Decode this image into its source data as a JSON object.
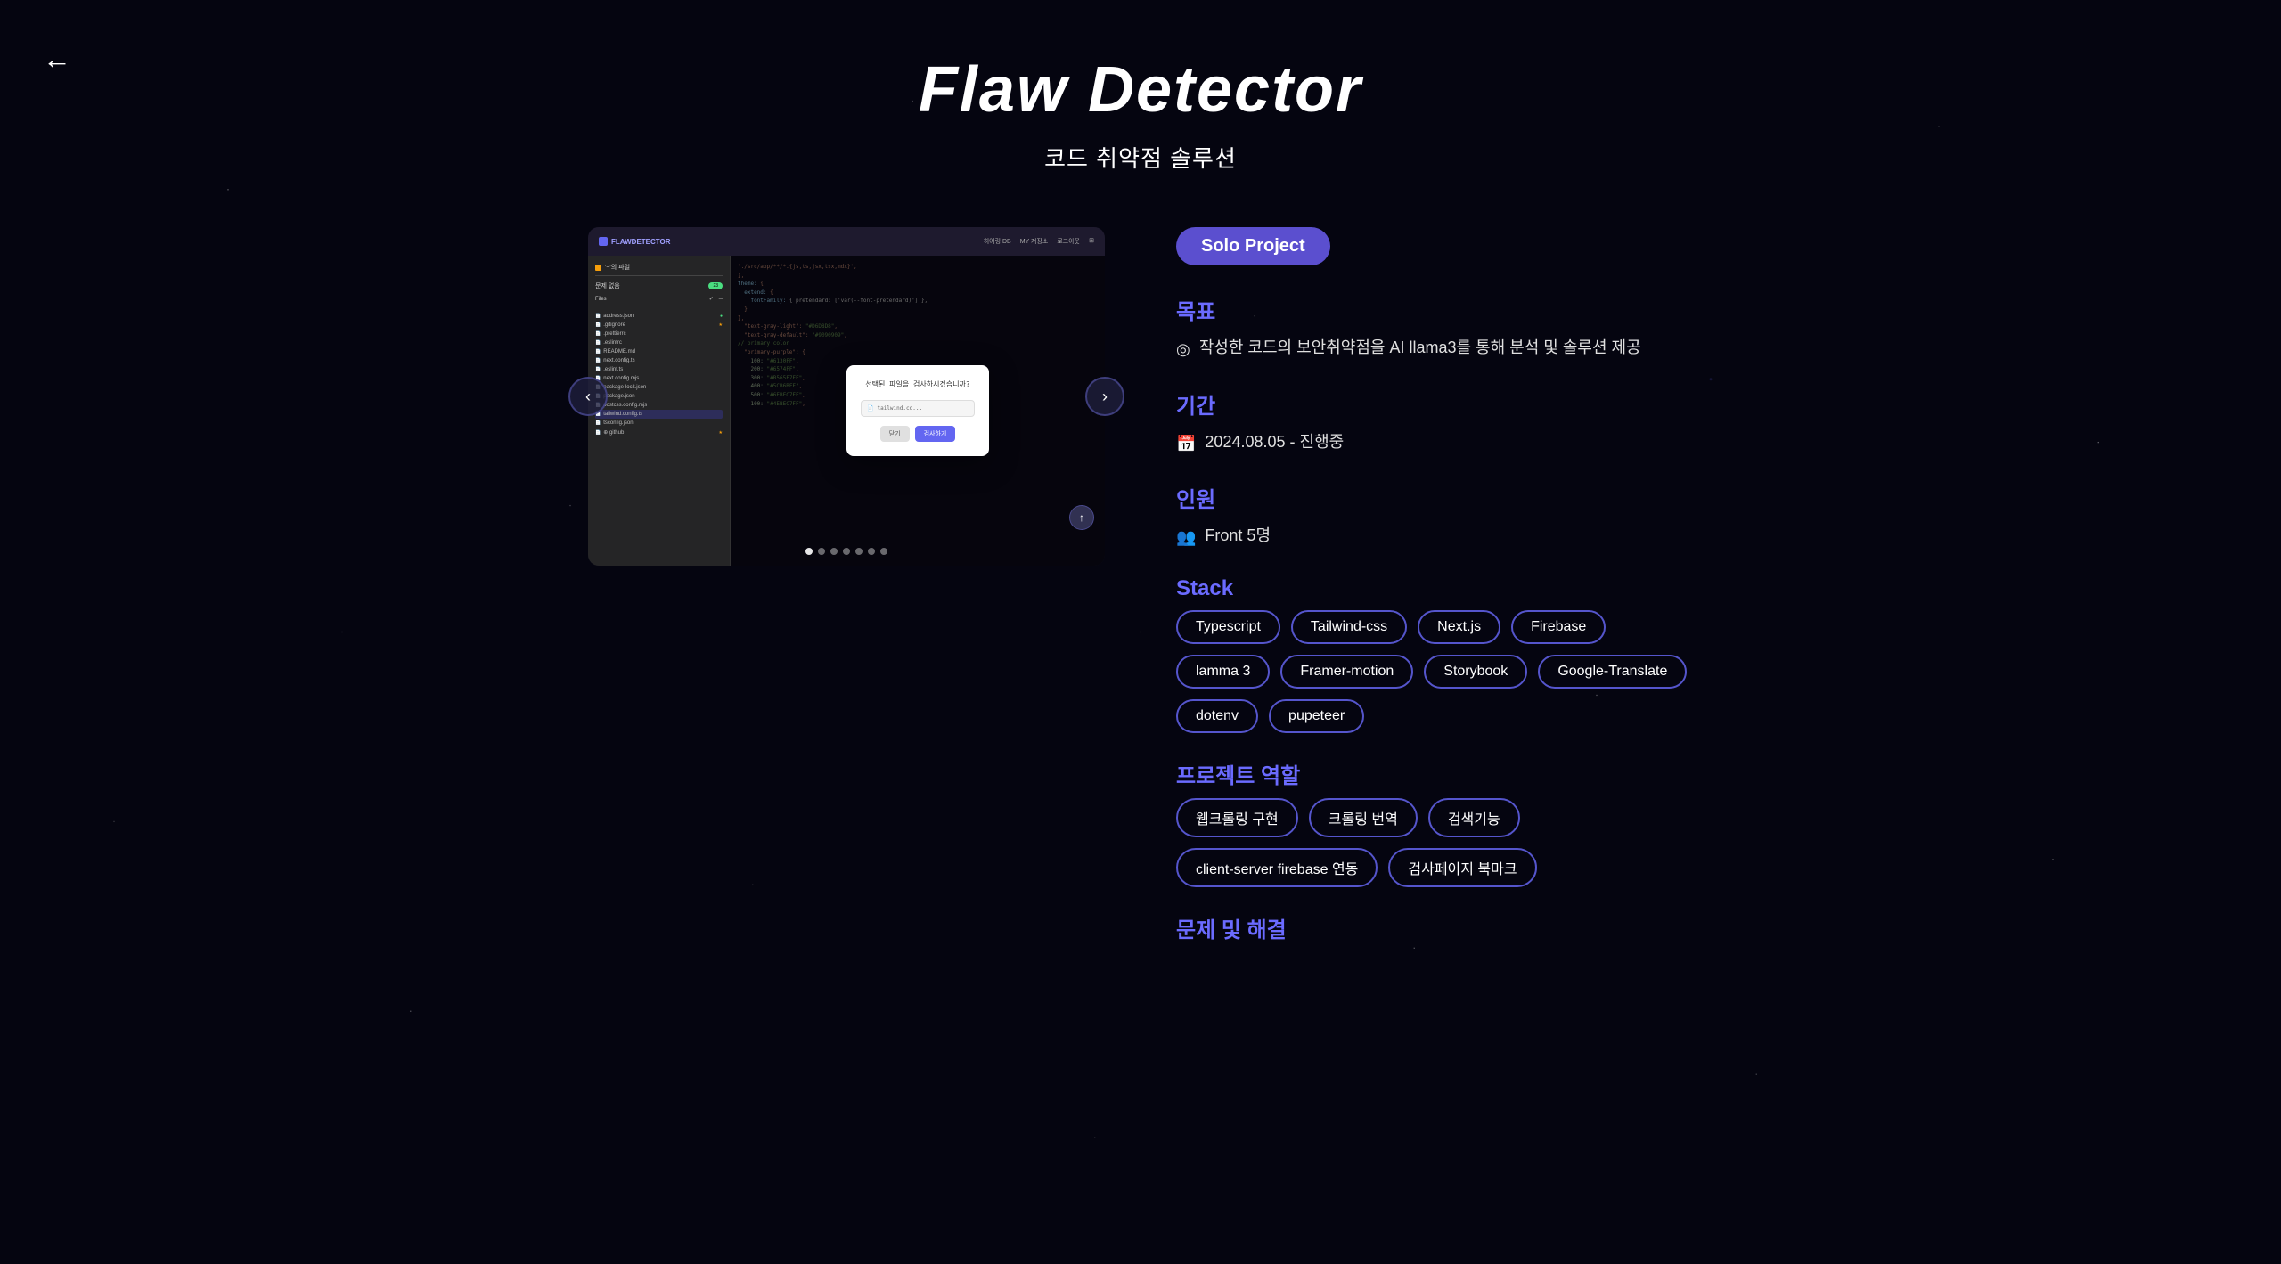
{
  "page": {
    "title": "Flaw Detector",
    "subtitle": "코드 취약점 솔루션",
    "back_label": "←"
  },
  "badge": {
    "label": "Solo Project"
  },
  "sections": {
    "goal": {
      "label": "목표",
      "icon": "◎",
      "content": "작성한 코드의 보안취약점을 AI llama3를 통해 분석 및 솔루션 제공"
    },
    "period": {
      "label": "기간",
      "icon": "📅",
      "content": "2024.08.05 - 진행중"
    },
    "team": {
      "label": "인원",
      "icon": "👥",
      "content": "Front 5명"
    },
    "stack": {
      "label": "Stack",
      "tags": [
        "Typescript",
        "Tailwind-css",
        "Next.js",
        "Firebase",
        "lamma 3",
        "Framer-motion",
        "Storybook",
        "Google-Translate",
        "dotenv",
        "pupeteer"
      ]
    },
    "role": {
      "label": "프로젝트 역할",
      "tags": [
        "웹크롤링 구현",
        "크롤링 번역",
        "검색기능",
        "client-server firebase 연동",
        "검사페이지 북마크"
      ]
    },
    "issues": {
      "label": "문제 및 해결"
    }
  },
  "carousel": {
    "dots_count": 7,
    "active_dot": 0
  },
  "mockup": {
    "logo": "FLAWDETECTOR",
    "nav_items": [
      "히어링 DB",
      "MY 저장소",
      "로그아웃"
    ],
    "modal_title": "선택된 파일을 검사하시겠습니까?",
    "modal_file": "tailwind.co...",
    "modal_cancel": "닫기",
    "modal_confirm": "검사하기",
    "file_count_label": "문제 없음",
    "file_count": "23",
    "files_header": "Files",
    "file_items": [
      "address.json",
      ".gitignore",
      ".prettierrc",
      ".eslintrc",
      "README.md",
      "next.config.ts",
      ".eslint.ts",
      "next.config.mjs",
      "package-lock.json",
      "package.json",
      "postcss.config.mjs",
      "tailwind.config.ts",
      "tsconfig.json"
    ],
    "code_lines": [
      "'./src/app/**/*.{js,ts,jsx,tsx,mdx}',",
      "},",
      "theme: {",
      "  extend: {",
      "    fontFamily: { pretendard: ['var(--font-pretendard)'] },",
      "  }",
      "},",
      "\"text-gray-light\": \"#D6D8D8\",",
      "\"text-gray-default\": \"#9090909\",",
      "",
      "// primary color",
      "\"primary-purple\": {",
      "  100: \"#6130FF\",",
      "  200: \"#6574FF\",",
      "  300: \"#B565F7FF\",",
      "  400: \"#5CB6BFF\",",
      "  500: \"#6EBEC7FF\",",
      "  100: \"#4EBEC7FF\","
    ]
  }
}
